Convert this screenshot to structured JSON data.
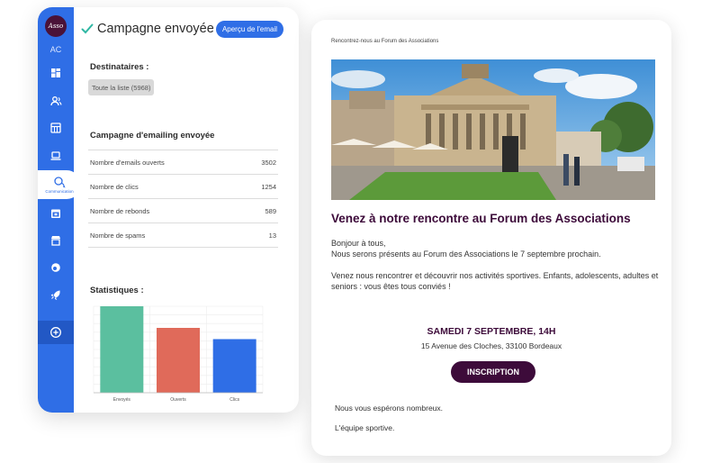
{
  "app": {
    "logo_text": "Asso",
    "user_initials": "AC",
    "nav": [
      {
        "name": "dashboard",
        "icon": "dashboard-icon"
      },
      {
        "name": "members",
        "icon": "members-icon"
      },
      {
        "name": "calendar",
        "icon": "calendar-grid-icon"
      },
      {
        "name": "computer",
        "icon": "laptop-icon"
      },
      {
        "name": "communication",
        "icon": "chat-bubbles-icon",
        "label": "Communication",
        "active": true
      },
      {
        "name": "events",
        "icon": "calendar-event-icon"
      },
      {
        "name": "shop",
        "icon": "shop-icon"
      },
      {
        "name": "finance",
        "icon": "coins-icon"
      },
      {
        "name": "launch",
        "icon": "rocket-icon"
      }
    ],
    "add_icon": "plus-circle-icon",
    "title": "Campagne envoyée !",
    "preview_button": "Aperçu de l'email",
    "recipients_title": "Destinataires :",
    "recipients_chip": "Toute la liste (5968)",
    "campaign_title": "Campagne d'emailing envoyée",
    "stats": [
      {
        "label": "Nombre d'emails ouverts",
        "value": "3502"
      },
      {
        "label": "Nombre de clics",
        "value": "1254"
      },
      {
        "label": "Nombre de rebonds",
        "value": "589"
      },
      {
        "label": "Nombre de spams",
        "value": "13"
      }
    ],
    "statistics_title": "Statistiques :"
  },
  "chart_data": {
    "type": "bar",
    "categories": [
      "Envoyés",
      "Ouverts",
      "Clics"
    ],
    "values": [
      100,
      75,
      62
    ],
    "colors": [
      "#5bbf9f",
      "#e06a5a",
      "#2f6ee6"
    ],
    "ylim": [
      0,
      100
    ],
    "grid": true
  },
  "email": {
    "preheader": "Rencontrez-nous au Forum des Associations",
    "heading": "Venez à notre rencontre au Forum des Associations",
    "greeting": "Bonjour à tous,",
    "line1": "Nous serons présents au Forum des Associations le 7 septembre prochain.",
    "line2": "Venez nous rencontrer et découvrir nos activités sportives. Enfants, adolescents, adultes et seniors : vous êtes tous conviés !",
    "event_date": "SAMEDI 7 SEPTEMBRE, 14H",
    "event_address": "15 Avenue des Cloches, 33100 Bordeaux",
    "cta": "INSCRIPTION",
    "closing1": "Nous vous espérons nombreux.",
    "closing2": "L'équipe sportive."
  },
  "colors": {
    "accent": "#2f6ee6",
    "brand_dark": "#3d0b3a",
    "success": "#2fb7a3"
  }
}
